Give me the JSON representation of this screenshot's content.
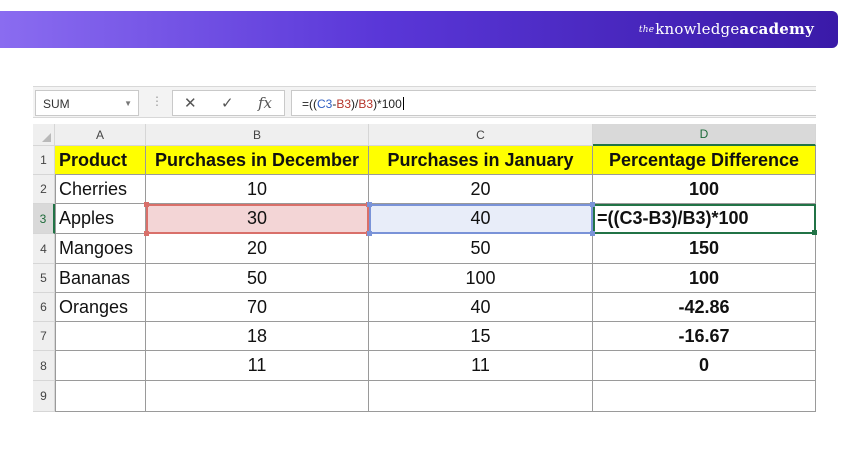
{
  "banner": {
    "brand_prefix": "the",
    "brand_main": "knowledge",
    "brand_accent": "academy",
    "gradient": [
      "#8a6cf0",
      "#3a1aa8"
    ]
  },
  "formula_bar": {
    "name_box": "SUM",
    "name_box_icon": "dropdown-arrow-icon",
    "cancel_icon": "close-icon",
    "enter_icon": "check-icon",
    "function_icon": "fx-icon",
    "cancel_glyph": "✕",
    "enter_glyph": "✓",
    "function_glyph": "fx",
    "formula_parts": [
      "=((",
      "C3",
      "-",
      "B3",
      ")/",
      "B3",
      ")*100"
    ]
  },
  "sheet": {
    "columns": [
      "A",
      "B",
      "C",
      "D"
    ],
    "row_numbers": [
      "1",
      "2",
      "3",
      "4",
      "5",
      "6",
      "7",
      "8",
      "9"
    ],
    "active_column": "D",
    "active_row": "3",
    "rows": [
      [
        "Product",
        "Purchases in December",
        "Purchases in January",
        "Percentage Difference"
      ],
      [
        "Cherries",
        "10",
        "20",
        "100"
      ],
      [
        "Apples",
        "30",
        "40",
        "=((C3-B3)/B3)*100"
      ],
      [
        "Mangoes",
        "20",
        "50",
        "150"
      ],
      [
        "Bananas",
        "50",
        "100",
        "100"
      ],
      [
        "Oranges",
        "70",
        "40",
        "-42.86"
      ],
      [
        "",
        "18",
        "15",
        "-16.67"
      ],
      [
        "",
        "11",
        "11",
        "0"
      ],
      [
        "",
        "",
        "",
        ""
      ]
    ],
    "colors": {
      "header_fill": "#ffff00",
      "ref_b_fill": "#f3d5d6",
      "ref_b_border": "#d9706a",
      "ref_c_fill": "#e8edf9",
      "ref_c_border": "#7a93d8",
      "active_border": "#217346"
    }
  }
}
